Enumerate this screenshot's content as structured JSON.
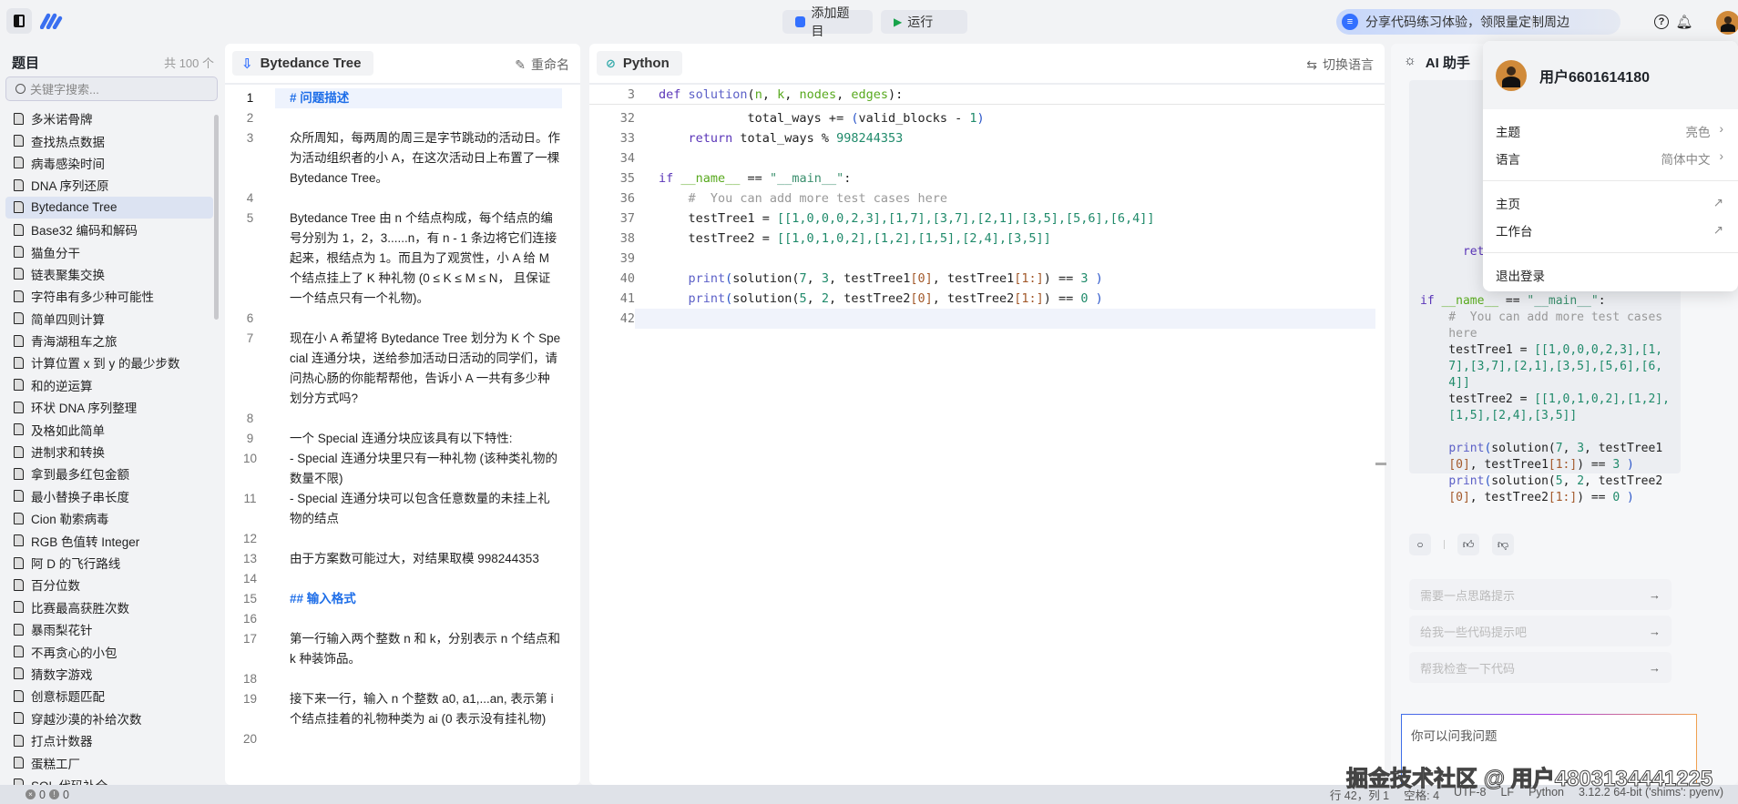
{
  "topbar": {
    "add_label": "添加题目",
    "run_label": "运行",
    "promo": "分享代码练习体验，领限量定制周边"
  },
  "sidebar": {
    "title": "题目",
    "count": "共 100 个",
    "search_placeholder": "关键字搜索...",
    "active_index": 4,
    "items": [
      "多米诺骨牌",
      "查找热点数据",
      "病毒感染时间",
      "DNA 序列还原",
      "Bytedance Tree",
      "Base32 编码和解码",
      "猫鱼分干",
      "链表聚集交换",
      "字符串有多少种可能性",
      "简单四则计算",
      "青海湖租车之旅",
      "计算位置 x 到 y 的最少步数",
      "和的逆运算",
      "环状 DNA 序列整理",
      "及格如此简单",
      "进制求和转换",
      "拿到最多红包金额",
      "最小替换子串长度",
      "Cion 勒索病毒",
      "RGB 色值转 Integer",
      "阿 D 的飞行路线",
      "百分位数",
      "比赛最高获胜次数",
      "暴雨梨花针",
      "不再贪心的小包",
      "猜数字游戏",
      "创意标题匹配",
      "穿越沙漠的补给次数",
      "打点计数器",
      "蛋糕工厂",
      "SQL 代码补全"
    ]
  },
  "desc": {
    "tab": "Bytedance Tree",
    "rename": "重命名",
    "lines": [
      {
        "n": "1",
        "t": "# 问题描述",
        "kind": "h"
      },
      {
        "n": "2",
        "t": ""
      },
      {
        "n": "3",
        "t": "众所周知，每两周的周三是字节跳动的活动日。作为活动组织者的小 A，在这次活动日上布置了一棵 Bytedance Tree。"
      },
      {
        "n": "4",
        "t": ""
      },
      {
        "n": "5",
        "t": "Bytedance Tree 由 n 个结点构成，每个结点的编号分别为 1，2，3......n，有 n - 1 条边将它们连接起来，根结点为 1。而且为了观赏性，小 A 给 M 个结点挂上了 K 种礼物 (0 ≤  K ≤  M  ≤  N， 且保证一个结点只有一个礼物)。"
      },
      {
        "n": "6",
        "t": ""
      },
      {
        "n": "7",
        "t": "现在小 A 希望将 Bytedance Tree 划分为 K 个 Special 连通分块，送给参加活动日活动的同学们，请问热心肠的你能帮帮他，告诉小 A 一共有多少种划分方式吗?"
      },
      {
        "n": "8",
        "t": ""
      },
      {
        "n": "9",
        "t": "一个 Special 连通分块应该具有以下特性:"
      },
      {
        "n": "10",
        "t": "- Special 连通分块里只有一种礼物 (该种类礼物的数量不限)"
      },
      {
        "n": "11",
        "t": "- Special 连通分块可以包含任意数量的未挂上礼物的结点"
      },
      {
        "n": "12",
        "t": ""
      },
      {
        "n": "13",
        "t": "由于方案数可能过大，对结果取模 998244353"
      },
      {
        "n": "14",
        "t": ""
      },
      {
        "n": "15",
        "t": "## 输入格式",
        "kind": "h"
      },
      {
        "n": "16",
        "t": ""
      },
      {
        "n": "17",
        "t": "第一行输入两个整数 n 和 k，分别表示 n 个结点和 k 种装饰品。"
      },
      {
        "n": "18",
        "t": ""
      },
      {
        "n": "19",
        "t": "接下来一行，输入 n 个整数 a0, a1,...an, 表示第 i 个结点挂着的礼物种类为 ai (0 表示没有挂礼物)"
      },
      {
        "n": "20",
        "t": ""
      }
    ]
  },
  "code": {
    "tab": "Python",
    "switch": "切换语言",
    "sticky": {
      "n": "3",
      "tokens": [
        [
          "def ",
          "k"
        ],
        [
          "solution",
          "f"
        ],
        [
          "(",
          "o"
        ],
        [
          "n",
          "p"
        ],
        [
          ", ",
          "o"
        ],
        [
          "k",
          "p"
        ],
        [
          ", ",
          "o"
        ],
        [
          "nodes",
          "p"
        ],
        [
          ", ",
          "o"
        ],
        [
          "edges",
          "p"
        ],
        [
          "):",
          "o"
        ]
      ]
    },
    "lines": [
      {
        "n": "32",
        "tokens": [
          [
            "            total_ways += ",
            "o"
          ],
          [
            "(",
            "b"
          ],
          [
            "valid_blocks - ",
            "o"
          ],
          [
            "1",
            "num"
          ],
          [
            ")",
            "b"
          ]
        ]
      },
      {
        "n": "33",
        "tokens": [
          [
            "    ",
            "o"
          ],
          [
            "return ",
            "k"
          ],
          [
            "total_ways % ",
            "o"
          ],
          [
            "998244353",
            "num"
          ]
        ]
      },
      {
        "n": "34",
        "tokens": []
      },
      {
        "n": "35",
        "tokens": [
          [
            "if ",
            "k"
          ],
          [
            "__name__",
            "p"
          ],
          [
            " == ",
            "o"
          ],
          [
            "\"__main__\"",
            "s"
          ],
          [
            ":",
            "o"
          ]
        ]
      },
      {
        "n": "36",
        "tokens": [
          [
            "    #  You can add more test cases here",
            "cm"
          ]
        ]
      },
      {
        "n": "37",
        "tokens": [
          [
            "    testTree1 = ",
            "o"
          ],
          [
            "[[1,0,0,0,2,3],[1,7],[3,7],[2,1],[3,5],[5,6],[6,4]]",
            "num"
          ]
        ]
      },
      {
        "n": "38",
        "tokens": [
          [
            "    testTree2 = ",
            "o"
          ],
          [
            "[[1,0,1,0,2],[1,2],[1,5],[2,4],[3,5]]",
            "num"
          ]
        ]
      },
      {
        "n": "39",
        "tokens": []
      },
      {
        "n": "40",
        "tokens": [
          [
            "    ",
            "o"
          ],
          [
            "print",
            "f"
          ],
          [
            "(",
            "b"
          ],
          [
            "solution(",
            "o"
          ],
          [
            "7",
            "num"
          ],
          [
            ", ",
            "o"
          ],
          [
            "3",
            "num"
          ],
          [
            ", testTree1",
            "o"
          ],
          [
            "[0]",
            "br"
          ],
          [
            ", testTree1",
            "o"
          ],
          [
            "[1:]",
            "br"
          ],
          [
            ") == ",
            "o"
          ],
          [
            "3",
            "num"
          ],
          [
            " )",
            "b"
          ]
        ]
      },
      {
        "n": "41",
        "tokens": [
          [
            "    ",
            "o"
          ],
          [
            "print",
            "f"
          ],
          [
            "(",
            "b"
          ],
          [
            "solution(",
            "o"
          ],
          [
            "5",
            "num"
          ],
          [
            ", ",
            "o"
          ],
          [
            "2",
            "num"
          ],
          [
            ", testTree2",
            "o"
          ],
          [
            "[0]",
            "br"
          ],
          [
            ", testTree2",
            "o"
          ],
          [
            "[1:]",
            "br"
          ],
          [
            ") == ",
            "o"
          ],
          [
            "0",
            "num"
          ],
          [
            " )",
            "b"
          ]
        ]
      },
      {
        "n": "42",
        "tokens": [],
        "current": true
      }
    ]
  },
  "ai": {
    "title": "AI 助手",
    "code_lines": [
      [
        [
          "",
          "o"
        ]
      ],
      [
        [
          "",
          "o"
        ]
      ],
      [
        [
          "",
          "o"
        ]
      ],
      [
        [
          "",
          "o"
        ]
      ],
      [
        [
          "",
          "o"
        ]
      ],
      [
        [
          "",
          "o"
        ]
      ],
      [
        [
          "",
          "o"
        ]
      ],
      [
        [
          "              if",
          "k"
        ]
      ],
      [
        [
          "",
          "o"
        ]
      ],
      [
        [
          "",
          "o"
        ]
      ],
      [
        [
          "      return",
          "k"
        ]
      ],
      [
        [
          "",
          "o"
        ]
      ],
      [
        [
          "",
          "o"
        ]
      ],
      [
        [
          "if ",
          "k"
        ],
        [
          "__name__",
          "p"
        ],
        [
          " == ",
          "o"
        ],
        [
          "\"__main__\"",
          "s"
        ],
        [
          ":",
          "o"
        ]
      ],
      [
        [
          "    #  You can add more test cases",
          "cm"
        ]
      ],
      [
        [
          "    here",
          "cm"
        ]
      ],
      [
        [
          "    testTree1 = ",
          "o"
        ],
        [
          "[[1,0,0,0,2,3],[1,",
          "num"
        ]
      ],
      [
        [
          "    7],[3,7],[2,1],[3,5],[5,6],[6,",
          "num"
        ]
      ],
      [
        [
          "    4]]",
          "num"
        ]
      ],
      [
        [
          "    testTree2 = ",
          "o"
        ],
        [
          "[[1,0,1,0,2],[1,2],",
          "num"
        ]
      ],
      [
        [
          "    [1,5],[2,4],[3,5]]",
          "num"
        ]
      ],
      [
        [
          "",
          "o"
        ]
      ],
      [
        [
          "    ",
          "o"
        ],
        [
          "print",
          "f"
        ],
        [
          "(",
          "b"
        ],
        [
          "solution(",
          "o"
        ],
        [
          "7",
          "num"
        ],
        [
          ", ",
          "o"
        ],
        [
          "3",
          "num"
        ],
        [
          ", testTree1",
          "o"
        ]
      ],
      [
        [
          "    ",
          "o"
        ],
        [
          "[0]",
          "br"
        ],
        [
          ", testTree1",
          "o"
        ],
        [
          "[1:]",
          "br"
        ],
        [
          ") == ",
          "o"
        ],
        [
          "3",
          "num"
        ],
        [
          " )",
          "b"
        ]
      ],
      [
        [
          "    ",
          "o"
        ],
        [
          "print",
          "f"
        ],
        [
          "(",
          "b"
        ],
        [
          "solution(",
          "o"
        ],
        [
          "5",
          "num"
        ],
        [
          ", ",
          "o"
        ],
        [
          "2",
          "num"
        ],
        [
          ", testTree2",
          "o"
        ]
      ],
      [
        [
          "    ",
          "o"
        ],
        [
          "[0]",
          "br"
        ],
        [
          ", testTree2",
          "o"
        ],
        [
          "[1:]",
          "br"
        ],
        [
          ") == ",
          "o"
        ],
        [
          "0",
          "num"
        ],
        [
          " )",
          "b"
        ]
      ]
    ],
    "suggestions": [
      "需要一点思路提示",
      "给我一些代码提示吧",
      "帮我检查一下代码"
    ],
    "input_placeholder": "你可以问我问题"
  },
  "menu": {
    "username": "用户6601614180",
    "theme_label": "主题",
    "theme_value": "亮色",
    "lang_label": "语言",
    "lang_value": "简体中文",
    "home": "主页",
    "workspace": "工作台",
    "logout": "退出登录"
  },
  "status": {
    "errors": "0",
    "warnings": "0",
    "position": "行 42，列 1",
    "spaces": "空格: 4",
    "encoding": "UTF-8",
    "eol": "LF",
    "language": "Python",
    "interpreter": "3.12.2 64-bit ('shims': pyenv)"
  },
  "watermark": "掘金技术社区 @ 用户4803134441225"
}
